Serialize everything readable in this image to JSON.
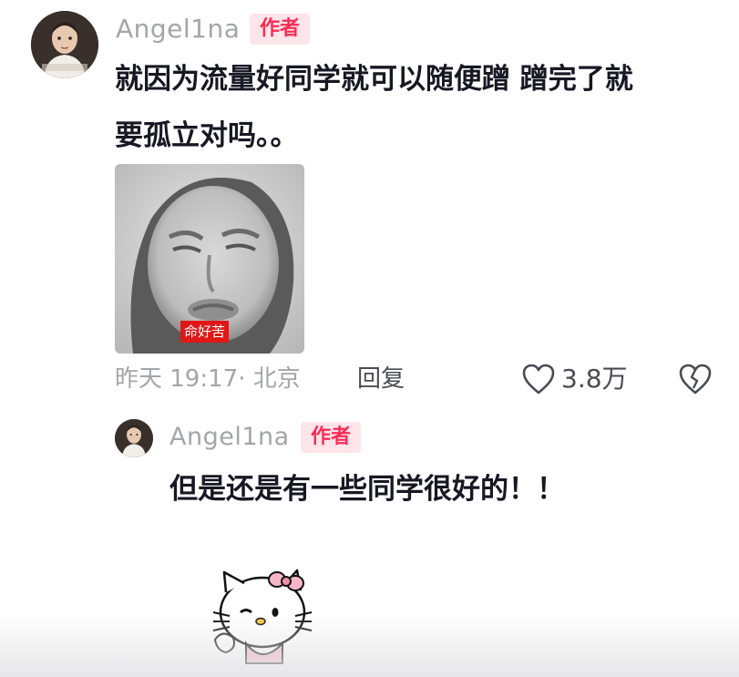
{
  "comment": {
    "username": "Angel1na",
    "author_badge": "作者",
    "text_line1": "就因为流量好同学就可以随便蹭 蹭完了就",
    "text_line2": "要孤立对吗。。",
    "image_caption": "命好苦",
    "time_location": "昨天 19:17· 北京",
    "reply_label": "回复",
    "like_count": "3.8万"
  },
  "reply": {
    "username": "Angel1na",
    "author_badge": "作者",
    "text": "但是还是有一些同学很好的！！"
  },
  "icons": {
    "like": "heart-outline-icon",
    "dislike": "broken-heart-icon"
  },
  "colors": {
    "author_badge_text": "#fe2c55",
    "author_badge_bg": "#fde5ea",
    "meta_text": "#a4a5aa"
  }
}
